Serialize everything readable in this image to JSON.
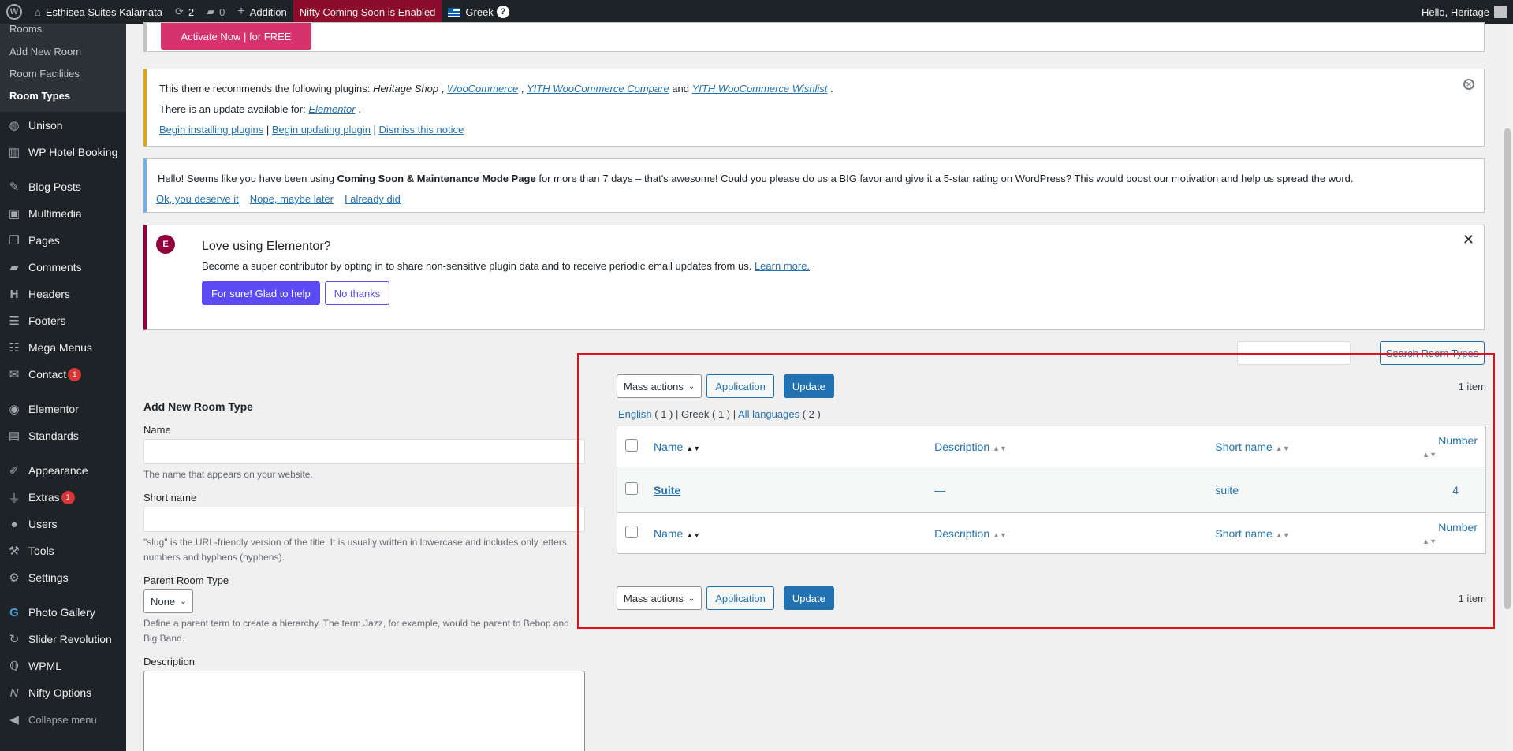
{
  "adminbar": {
    "site": "Esthisea Suites Kalamata",
    "updates": "2",
    "comments": "0",
    "new_label": "Addition",
    "nifty": "Nifty Coming Soon is Enabled",
    "lang": "Greek",
    "hello": "Hello, Heritage"
  },
  "sidebar": {
    "submenu": [
      "Rooms",
      "Add New Room",
      "Room Facilities",
      "Room Types"
    ],
    "items": [
      {
        "label": "Unison",
        "icon": "unison-icon"
      },
      {
        "label": "WP Hotel Booking",
        "icon": "hotel-icon"
      },
      {
        "label": "Blog Posts",
        "icon": "pin-icon"
      },
      {
        "label": "Multimedia",
        "icon": "media-icon"
      },
      {
        "label": "Pages",
        "icon": "pages-icon"
      },
      {
        "label": "Comments",
        "icon": "comments-icon"
      },
      {
        "label": "Headers",
        "icon": "headers-icon"
      },
      {
        "label": "Footers",
        "icon": "footers-icon"
      },
      {
        "label": "Mega Menus",
        "icon": "menu-icon"
      },
      {
        "label": "Contact",
        "icon": "mail-icon",
        "badge": "1"
      },
      {
        "label": "Elementor",
        "icon": "elementor-icon"
      },
      {
        "label": "Standards",
        "icon": "folder-icon"
      },
      {
        "label": "Appearance",
        "icon": "brush-icon"
      },
      {
        "label": "Extras",
        "icon": "plugin-icon",
        "badge": "1"
      },
      {
        "label": "Users",
        "icon": "users-icon"
      },
      {
        "label": "Tools",
        "icon": "tools-icon"
      },
      {
        "label": "Settings",
        "icon": "settings-icon"
      },
      {
        "label": "Photo Gallery",
        "icon": "gallery-icon"
      },
      {
        "label": "Slider Revolution",
        "icon": "slider-icon"
      },
      {
        "label": "WPML",
        "icon": "wpml-icon"
      },
      {
        "label": "Nifty Options",
        "icon": "nifty-icon"
      }
    ],
    "collapse": "Collapse menu"
  },
  "notices": {
    "activate": "Activate Now | for FREE",
    "theme_pre": "This theme recommends the following plugins: ",
    "theme_p1": "Heritage Shop",
    "theme_p2": "WooCommerce",
    "theme_p3": "YITH WooCommerce Compare",
    "theme_and": " and ",
    "theme_p4": "YITH WooCommerce Wishlist",
    "update_pre": "There is an update available for: ",
    "update_p": "Elementor",
    "link_install": "Begin installing plugins",
    "link_update": "Begin updating plugin",
    "link_dismiss": "Dismiss this notice",
    "coming_pre": "Hello! Seems like you have been using ",
    "coming_bold": "Coming Soon & Maintenance Mode Page",
    "coming_post": " for more than 7 days – that's awesome! Could you please do us a BIG favor and give it a 5-star rating on WordPress? This would boost our motivation and help us spread the word.",
    "coming_l1": "Ok, you deserve it",
    "coming_l2": "Nope, maybe later",
    "coming_l3": "I already did",
    "el_title": "Love using Elementor?",
    "el_text": "Become a super contributor by opting in to share non-sensitive plugin data and to receive periodic email updates from us. ",
    "el_learn": "Learn more.",
    "el_yes": "For sure! Glad to help",
    "el_no": "No thanks"
  },
  "search": {
    "button": "Search Room Types"
  },
  "form": {
    "title": "Add New Room Type",
    "name_label": "Name",
    "name_help": "The name that appears on your website.",
    "short_label": "Short name",
    "short_help": "\"slug\" is the URL-friendly version of the title. It is usually written in lowercase and includes only letters, numbers and hyphens (hyphens).",
    "parent_label": "Parent Room Type",
    "parent_value": "None",
    "parent_help": "Define a parent term to create a hierarchy. The term Jazz, for example, would be parent to Bebop and Big Band.",
    "desc_label": "Description"
  },
  "list": {
    "mass_actions": "Mass actions",
    "apply": "Application",
    "update": "Update",
    "count": "1 item",
    "lang_en": "English",
    "lang_en_count": "( 1 )",
    "lang_gr": "Greek ( 1 )",
    "lang_all": "All languages",
    "lang_all_count": "( 2 )",
    "columns": {
      "name": "Name",
      "description": "Description",
      "short": "Short name",
      "number": "Number"
    },
    "rows": [
      {
        "name": "Suite",
        "description": "—",
        "short": "suite",
        "number": "4"
      }
    ]
  }
}
